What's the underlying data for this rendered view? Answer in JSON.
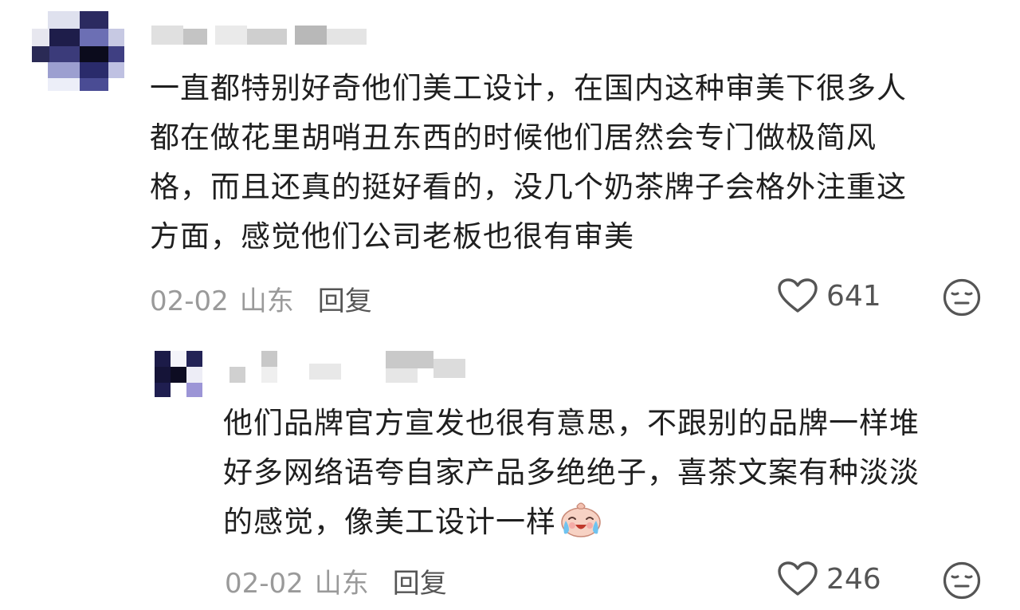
{
  "comments": [
    {
      "lines": [
        "一直都特别好奇他们美工设计，在国内这种审美下很多人",
        "都在做花里胡哨丑东西的时候他们居然会专门做极简风",
        "格，而且还真的挺好看的，没几个奶茶牌子会格外注重这",
        "方面，感觉他们公司老板也很有审美"
      ],
      "date": "02-02",
      "location": "山东",
      "reply_label": "回复",
      "likes": "641",
      "icons": [
        "heart-outline-icon",
        "neutral-face-icon"
      ]
    },
    {
      "lines": [
        "他们品牌官方宣发也很有意思，不跟别的品牌一样堆",
        "好多网络语夸自家产品多绝绝子，喜茶文案有种淡淡",
        "的感觉，像美工设计一样"
      ],
      "date": "02-02",
      "location": "山东",
      "reply_label": "回复",
      "likes": "246",
      "icons": [
        "crying-laughing-emoji-icon",
        "heart-outline-icon",
        "neutral-face-icon"
      ]
    }
  ],
  "colors": {
    "text": "#1f1f1f",
    "meta": "#9a9a9a",
    "icon": "#555555"
  }
}
